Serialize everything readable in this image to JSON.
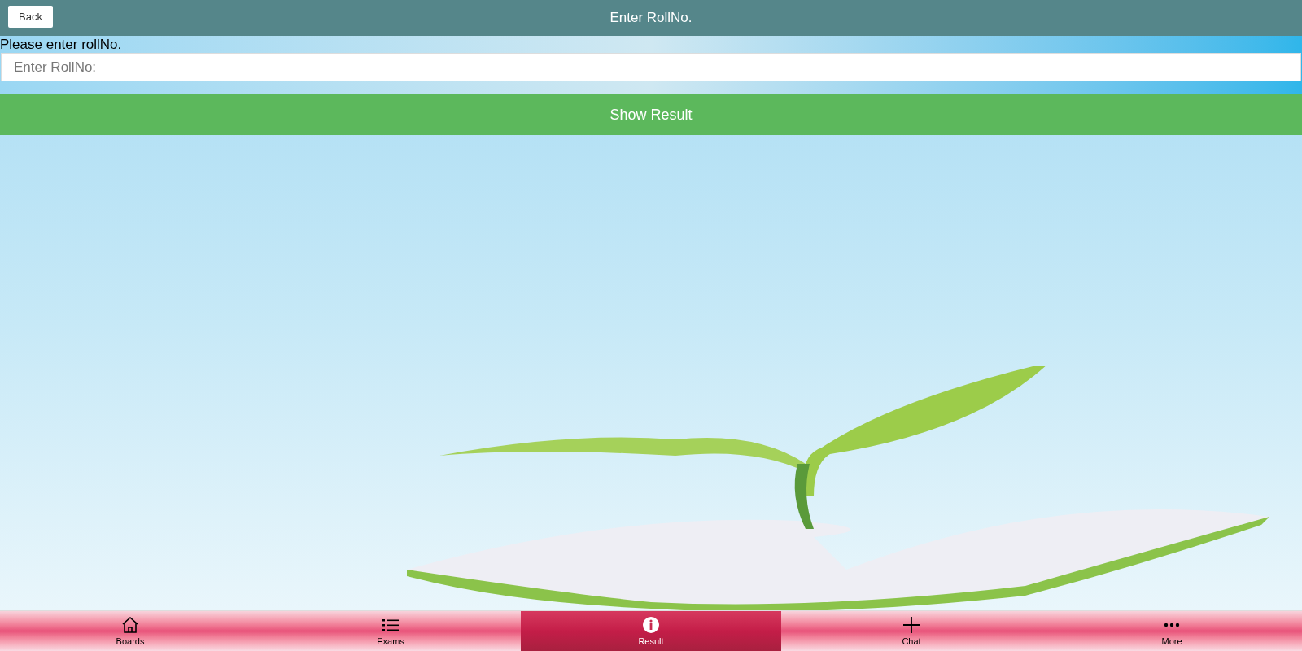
{
  "header": {
    "back_button": "Back",
    "title": "Enter RollNo."
  },
  "form": {
    "label": "Please enter rollNo.",
    "input": {
      "placeholder": "Enter RollNo:"
    },
    "submit_button": "Show Result"
  },
  "bottom_nav": [
    {
      "label": "Boards",
      "selected": false
    },
    {
      "label": "Exams",
      "selected": false
    },
    {
      "label": "Result",
      "selected": true
    },
    {
      "label": "Chat",
      "selected": false
    },
    {
      "label": "More",
      "selected": false
    }
  ]
}
